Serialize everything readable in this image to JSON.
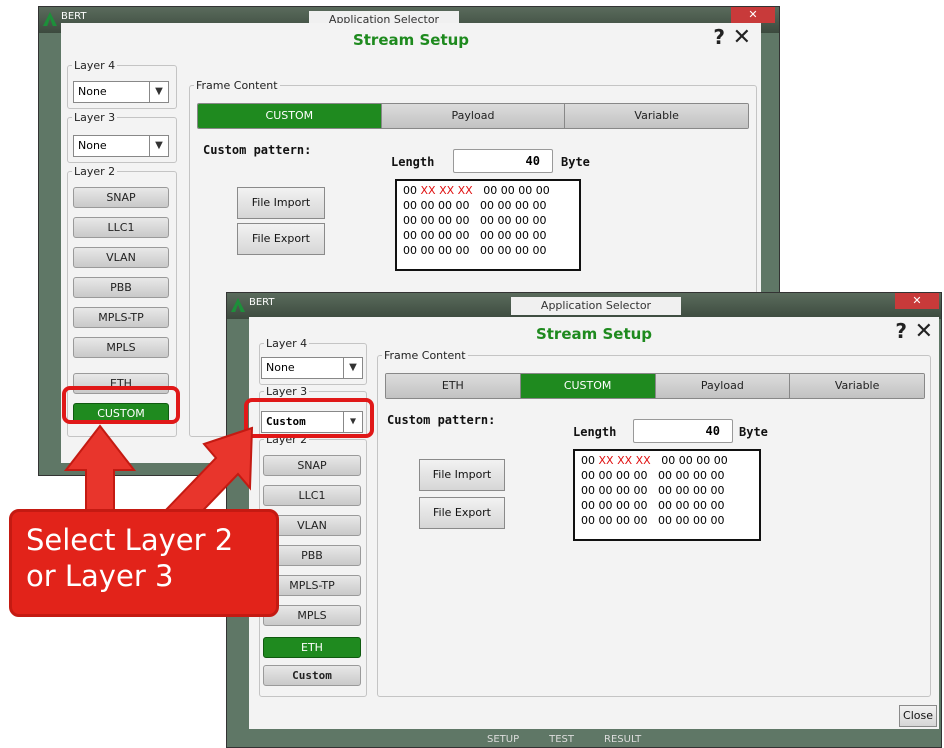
{
  "screen1": {
    "app_title": "BERT",
    "selector_label": "Application Selector",
    "dialog_title": "Stream Setup",
    "help": "?",
    "close": "✕",
    "layer4_label": "Layer 4",
    "layer4_value": "None",
    "layer3_label": "Layer 3",
    "layer3_value": "None",
    "layer2_label": "Layer 2",
    "layer2_buttons": [
      "SNAP",
      "LLC1",
      "VLAN",
      "PBB",
      "MPLS-TP",
      "MPLS",
      "ETH",
      "CUSTOM"
    ],
    "frame_content_label": "Frame Content",
    "tabs": [
      "CUSTOM",
      "Payload",
      "Variable"
    ],
    "custom_pattern_label": "Custom pattern:",
    "length_label": "Length",
    "length_value": "40",
    "byte_label": "Byte",
    "file_import": "File Import",
    "file_export": "File Export",
    "hex_first_red": "XX XX XX",
    "hex_rows": [
      "00 00 00 00   00 00 00 00",
      "00 00 00 00   00 00 00 00",
      "00 00 00 00   00 00 00 00",
      "00 00 00 00   00 00 00 00"
    ],
    "hex_first_prefix": "00 ",
    "hex_first_suffix": "   00 00 00 00"
  },
  "screen2": {
    "app_title": "BERT",
    "selector_label": "Application Selector",
    "dialog_title": "Stream Setup",
    "help": "?",
    "close": "✕",
    "layer4_label": "Layer 4",
    "layer4_value": "None",
    "layer3_label": "Layer 3",
    "layer3_value": "Custom",
    "layer2_label": "Layer 2",
    "layer2_buttons": [
      "SNAP",
      "LLC1",
      "VLAN",
      "PBB",
      "MPLS-TP",
      "MPLS",
      "ETH",
      "Custom"
    ],
    "frame_content_label": "Frame Content",
    "tabs": [
      "ETH",
      "CUSTOM",
      "Payload",
      "Variable"
    ],
    "custom_pattern_label": "Custom pattern:",
    "length_label": "Length",
    "length_value": "40",
    "byte_label": "Byte",
    "file_import": "File Import",
    "file_export": "File Export",
    "hex_first_prefix": "00 ",
    "hex_first_red": "XX XX XX",
    "hex_first_suffix": "   00 00 00 00",
    "hex_rows": [
      "00 00 00 00   00 00 00 00",
      "00 00 00 00   00 00 00 00",
      "00 00 00 00   00 00 00 00",
      "00 00 00 00   00 00 00 00"
    ],
    "close_button": "Close",
    "taskbar": [
      "SETUP",
      "TEST",
      "RESULT"
    ]
  },
  "callout": {
    "line1": "Select Layer 2",
    "line2": "or Layer 3"
  },
  "colors": {
    "accent_green": "#1f8a1f",
    "highlight_red": "#e01818",
    "title_green": "#1e8a1e"
  }
}
